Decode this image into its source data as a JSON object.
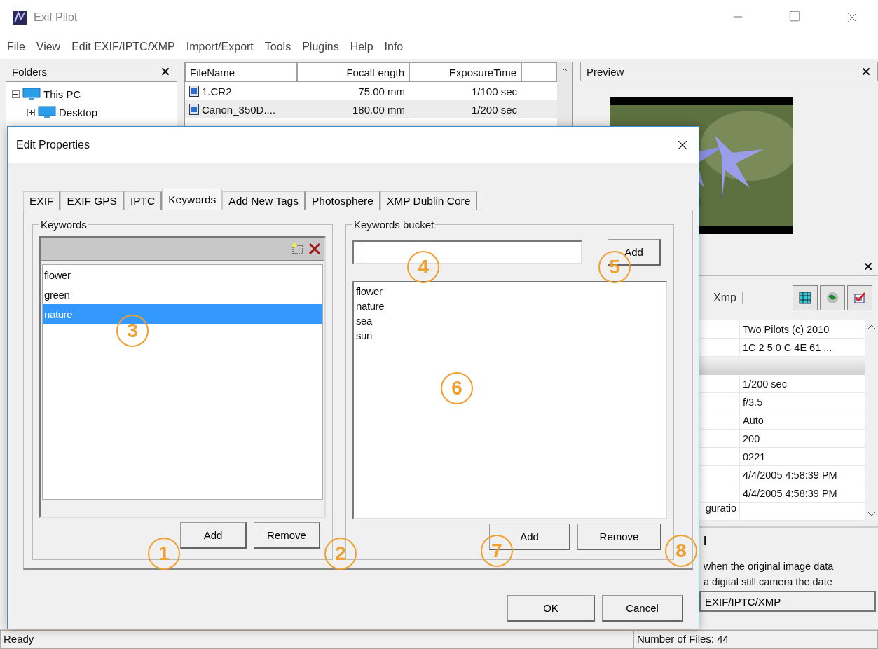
{
  "window": {
    "title": "Exif Pilot"
  },
  "menu": [
    "File",
    "View",
    "Edit EXIF/IPTC/XMP",
    "Import/Export",
    "Tools",
    "Plugins",
    "Help",
    "Info"
  ],
  "folders": {
    "title": "Folders",
    "tree": [
      {
        "label": "This PC",
        "expanded": true,
        "children": [
          {
            "label": "Desktop",
            "expanded": false
          }
        ]
      }
    ]
  },
  "file_list": {
    "columns": [
      "FileName",
      "FocalLength",
      "ExposureTime"
    ],
    "rows": [
      {
        "cells": [
          "1.CR2",
          "75.00 mm",
          "1/100 sec"
        ],
        "selected": false
      },
      {
        "cells": [
          "Canon_350D....",
          "180.00 mm",
          "1/200 sec"
        ],
        "selected": true
      }
    ]
  },
  "preview": {
    "title": "Preview"
  },
  "properties": {
    "tabs": [
      {
        "label": "Xmp",
        "selected": false
      }
    ],
    "rows": [
      {
        "kind": "value",
        "value": "Two Pilots (c) 2010"
      },
      {
        "kind": "value",
        "value": "1C  2  5  0  C 4E 61 ..."
      },
      {
        "kind": "section"
      },
      {
        "kind": "value",
        "value": "1/200 sec"
      },
      {
        "kind": "value",
        "value": "f/3.5"
      },
      {
        "kind": "value",
        "value": "Auto"
      },
      {
        "kind": "value",
        "value": "200"
      },
      {
        "kind": "value",
        "value": "0221"
      },
      {
        "kind": "value",
        "value": "4/4/2005 4:58:39 PM"
      },
      {
        "kind": "value",
        "value": "4/4/2005 4:58:39 PM"
      },
      {
        "kind": "label",
        "label": "guratio"
      }
    ],
    "description": {
      "title": "l",
      "lines": [
        "when the original image data",
        "a digital still camera the date"
      ]
    },
    "edit_button": "EXIF/IPTC/XMP"
  },
  "status_bar": [
    "Ready",
    "Number of Files: 44"
  ],
  "dialog": {
    "title": "Edit Properties",
    "tabs": [
      {
        "label": "EXIF",
        "selected": false
      },
      {
        "label": "EXIF GPS",
        "selected": false
      },
      {
        "label": "IPTC",
        "selected": false
      },
      {
        "label": "Keywords",
        "selected": true
      },
      {
        "label": "Add New Tags",
        "selected": false
      },
      {
        "label": "Photosphere",
        "selected": false
      },
      {
        "label": "XMP Dublin Core",
        "selected": false
      }
    ],
    "keywords": {
      "title": "Keywords",
      "items": [
        {
          "label": "flower",
          "selected": false
        },
        {
          "label": "green",
          "selected": false
        },
        {
          "label": "nature",
          "selected": true
        }
      ],
      "buttons": [
        "Add",
        "Remove"
      ]
    },
    "bucket": {
      "title": "Keywords bucket",
      "add_button": "Add",
      "items": [
        "flower",
        "nature",
        "sea",
        "sun"
      ],
      "buttons": [
        "Add",
        "Remove"
      ]
    },
    "buttons": [
      "OK",
      "Cancel"
    ]
  },
  "markers": [
    "1",
    "2",
    "3",
    "4",
    "5",
    "6",
    "7",
    "8"
  ]
}
